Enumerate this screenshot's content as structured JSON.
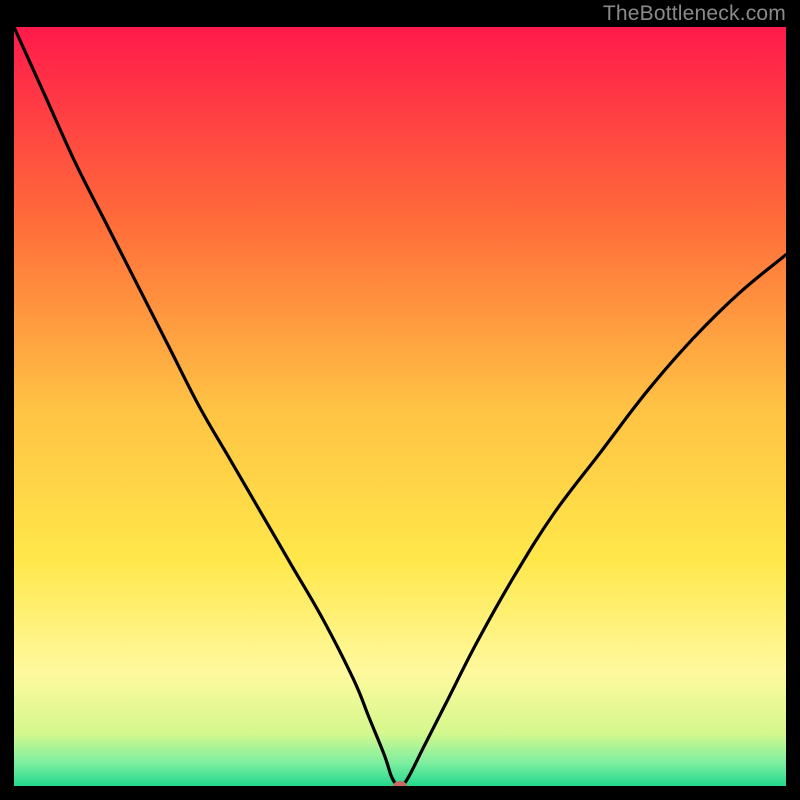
{
  "watermark": "TheBottleneck.com",
  "chart_data": {
    "type": "line",
    "title": "",
    "xlabel": "",
    "ylabel": "",
    "xlim": [
      0,
      100
    ],
    "ylim": [
      0,
      100
    ],
    "grid": false,
    "legend": false,
    "background": {
      "type": "vertical_gradient",
      "stops": [
        {
          "pos": 0.0,
          "color": "#ff1a4b"
        },
        {
          "pos": 0.25,
          "color": "#ff6a3a"
        },
        {
          "pos": 0.5,
          "color": "#ffc244"
        },
        {
          "pos": 0.7,
          "color": "#ffe74a"
        },
        {
          "pos": 0.85,
          "color": "#fff99e"
        },
        {
          "pos": 0.93,
          "color": "#d5f88e"
        },
        {
          "pos": 0.97,
          "color": "#7ceea0"
        },
        {
          "pos": 1.0,
          "color": "#22d88d"
        }
      ]
    },
    "series": [
      {
        "name": "bottleneck-curve",
        "color": "#000000",
        "x": [
          0,
          4,
          8,
          12,
          16,
          20,
          24,
          28,
          32,
          36,
          40,
          44,
          46,
          48,
          49,
          50,
          51,
          53,
          56,
          60,
          65,
          70,
          76,
          82,
          88,
          94,
          100
        ],
        "y": [
          100,
          91,
          82,
          74,
          66,
          58,
          50,
          43,
          36,
          29,
          22,
          14,
          9,
          4,
          1,
          0,
          1,
          5,
          11,
          19,
          28,
          36,
          44,
          52,
          59,
          65,
          70
        ]
      }
    ],
    "marker": {
      "name": "optimum-marker",
      "x": 50,
      "y": 0,
      "rx": 7,
      "ry": 5,
      "color": "#c76b62"
    }
  }
}
